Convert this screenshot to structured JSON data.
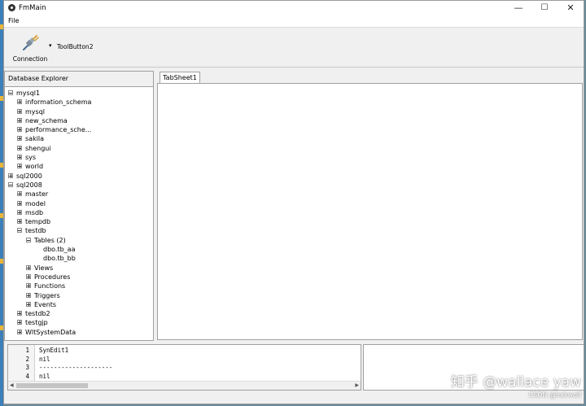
{
  "window": {
    "title": "FmMain",
    "min_glyph": "—",
    "max_glyph": "☐",
    "close_glyph": "✕"
  },
  "menu": {
    "file": "File"
  },
  "toolbar": {
    "connection_label": "Connection",
    "dropdown_glyph": "▾",
    "button2_label": "ToolButton2"
  },
  "explorer": {
    "header": "Database Explorer",
    "tree": [
      {
        "label": "mysql1",
        "level": 0,
        "state": "open"
      },
      {
        "label": "information_schema",
        "level": 1,
        "state": "closed"
      },
      {
        "label": "mysql",
        "level": 1,
        "state": "closed"
      },
      {
        "label": "new_schema",
        "level": 1,
        "state": "closed"
      },
      {
        "label": "performance_sche...",
        "level": 1,
        "state": "closed"
      },
      {
        "label": "sakila",
        "level": 1,
        "state": "closed"
      },
      {
        "label": "shengui",
        "level": 1,
        "state": "closed"
      },
      {
        "label": "sys",
        "level": 1,
        "state": "closed"
      },
      {
        "label": "world",
        "level": 1,
        "state": "closed"
      },
      {
        "label": "sql2000",
        "level": 0,
        "state": "closed"
      },
      {
        "label": "sql2008",
        "level": 0,
        "state": "open"
      },
      {
        "label": "master",
        "level": 1,
        "state": "closed"
      },
      {
        "label": "model",
        "level": 1,
        "state": "closed"
      },
      {
        "label": "msdb",
        "level": 1,
        "state": "closed"
      },
      {
        "label": "tempdb",
        "level": 1,
        "state": "closed"
      },
      {
        "label": "testdb",
        "level": 1,
        "state": "open"
      },
      {
        "label": "Tables (2)",
        "level": 2,
        "state": "open"
      },
      {
        "label": "dbo.tb_aa",
        "level": 3,
        "state": "leaf"
      },
      {
        "label": "dbo.tb_bb",
        "level": 3,
        "state": "leaf"
      },
      {
        "label": "Views",
        "level": 2,
        "state": "closed"
      },
      {
        "label": "Procedures",
        "level": 2,
        "state": "closed"
      },
      {
        "label": "Functions",
        "level": 2,
        "state": "closed"
      },
      {
        "label": "Triggers",
        "level": 2,
        "state": "closed"
      },
      {
        "label": "Events",
        "level": 2,
        "state": "closed"
      },
      {
        "label": "testdb2",
        "level": 1,
        "state": "closed"
      },
      {
        "label": "testgjp",
        "level": 1,
        "state": "closed"
      },
      {
        "label": "WltSystemData",
        "level": 1,
        "state": "closed"
      }
    ]
  },
  "tabs": [
    {
      "label": "TabSheet1"
    }
  ],
  "editor": {
    "lines": [
      {
        "num": "1",
        "text": "SynEdit1"
      },
      {
        "num": "2",
        "text": "nil"
      },
      {
        "num": "3",
        "text": "--------------------"
      },
      {
        "num": "4",
        "text": "nil"
      }
    ]
  },
  "watermark": {
    "main": "知乎 @wallace yaw",
    "sub": "CSDN @hakwolf"
  }
}
